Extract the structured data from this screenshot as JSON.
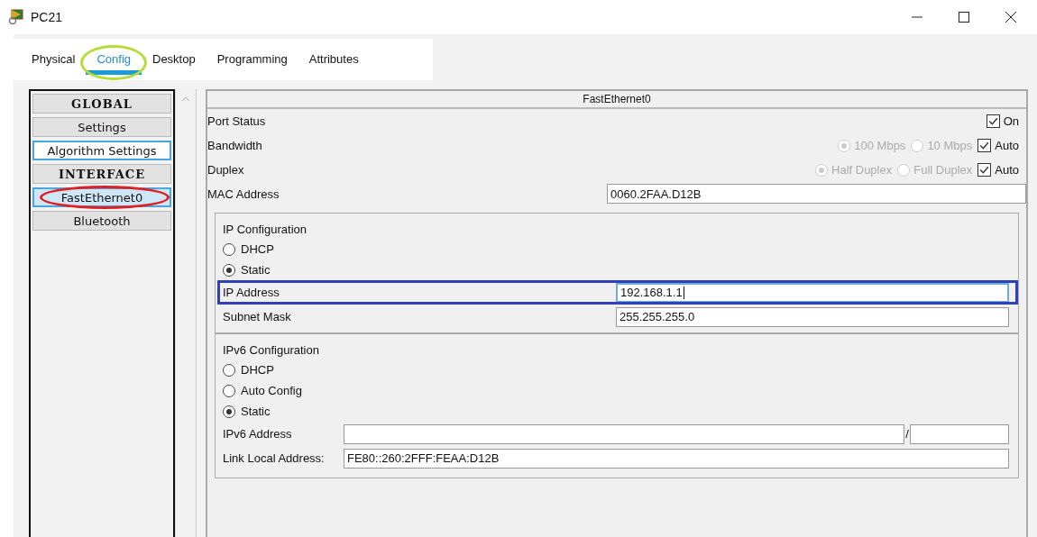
{
  "window": {
    "title": "PC21"
  },
  "tabs": [
    {
      "label": "Physical",
      "selected": false,
      "highlighted": false
    },
    {
      "label": "Config",
      "selected": true,
      "highlighted": true
    },
    {
      "label": "Desktop",
      "selected": false,
      "highlighted": false
    },
    {
      "label": "Programming",
      "selected": false,
      "highlighted": false
    },
    {
      "label": "Attributes",
      "selected": false,
      "highlighted": false
    }
  ],
  "sidebar": {
    "items": [
      {
        "label": "GLOBAL",
        "kind": "header",
        "selected": false,
        "focused": false,
        "highlighted": false
      },
      {
        "label": "Settings",
        "kind": "item",
        "selected": false,
        "focused": false,
        "highlighted": false
      },
      {
        "label": "Algorithm Settings",
        "kind": "item",
        "selected": false,
        "focused": true,
        "highlighted": false
      },
      {
        "label": "INTERFACE",
        "kind": "header",
        "selected": false,
        "focused": false,
        "highlighted": false
      },
      {
        "label": "FastEthernet0",
        "kind": "item",
        "selected": true,
        "focused": false,
        "highlighted": true
      },
      {
        "label": "Bluetooth",
        "kind": "item",
        "selected": false,
        "focused": false,
        "highlighted": false
      }
    ]
  },
  "panel": {
    "title": "FastEthernet0",
    "port_status": {
      "label": "Port Status",
      "option": {
        "label": "On",
        "checked": true
      }
    },
    "bandwidth": {
      "label": "Bandwidth",
      "options": [
        {
          "label": "100 Mbps",
          "selected": true,
          "disabled": true
        },
        {
          "label": "10 Mbps",
          "selected": false,
          "disabled": true
        }
      ],
      "auto": {
        "label": "Auto",
        "checked": true
      }
    },
    "duplex": {
      "label": "Duplex",
      "options": [
        {
          "label": "Half Duplex",
          "selected": true,
          "disabled": true
        },
        {
          "label": "Full Duplex",
          "selected": false,
          "disabled": true
        }
      ],
      "auto": {
        "label": "Auto",
        "checked": true
      }
    },
    "mac": {
      "label": "MAC Address",
      "value": "0060.2FAA.D12B"
    },
    "ip_config": {
      "title": "IP Configuration",
      "modes": [
        {
          "label": "DHCP",
          "selected": false
        },
        {
          "label": "Static",
          "selected": true
        }
      ],
      "fields": [
        {
          "label": "IP Address",
          "value": "192.168.1.1",
          "focused": true,
          "highlighted": true
        },
        {
          "label": "Subnet Mask",
          "value": "255.255.255.0",
          "focused": false,
          "highlighted": false
        }
      ]
    },
    "ipv6_config": {
      "title": "IPv6 Configuration",
      "modes": [
        {
          "label": "DHCP",
          "selected": false
        },
        {
          "label": "Auto Config",
          "selected": false
        },
        {
          "label": "Static",
          "selected": true
        }
      ],
      "address": {
        "label": "IPv6 Address",
        "separator": "/"
      },
      "link_local": {
        "label": "Link Local Address:",
        "value": "FE80::260:2FFF:FEAA:D12B"
      }
    }
  }
}
